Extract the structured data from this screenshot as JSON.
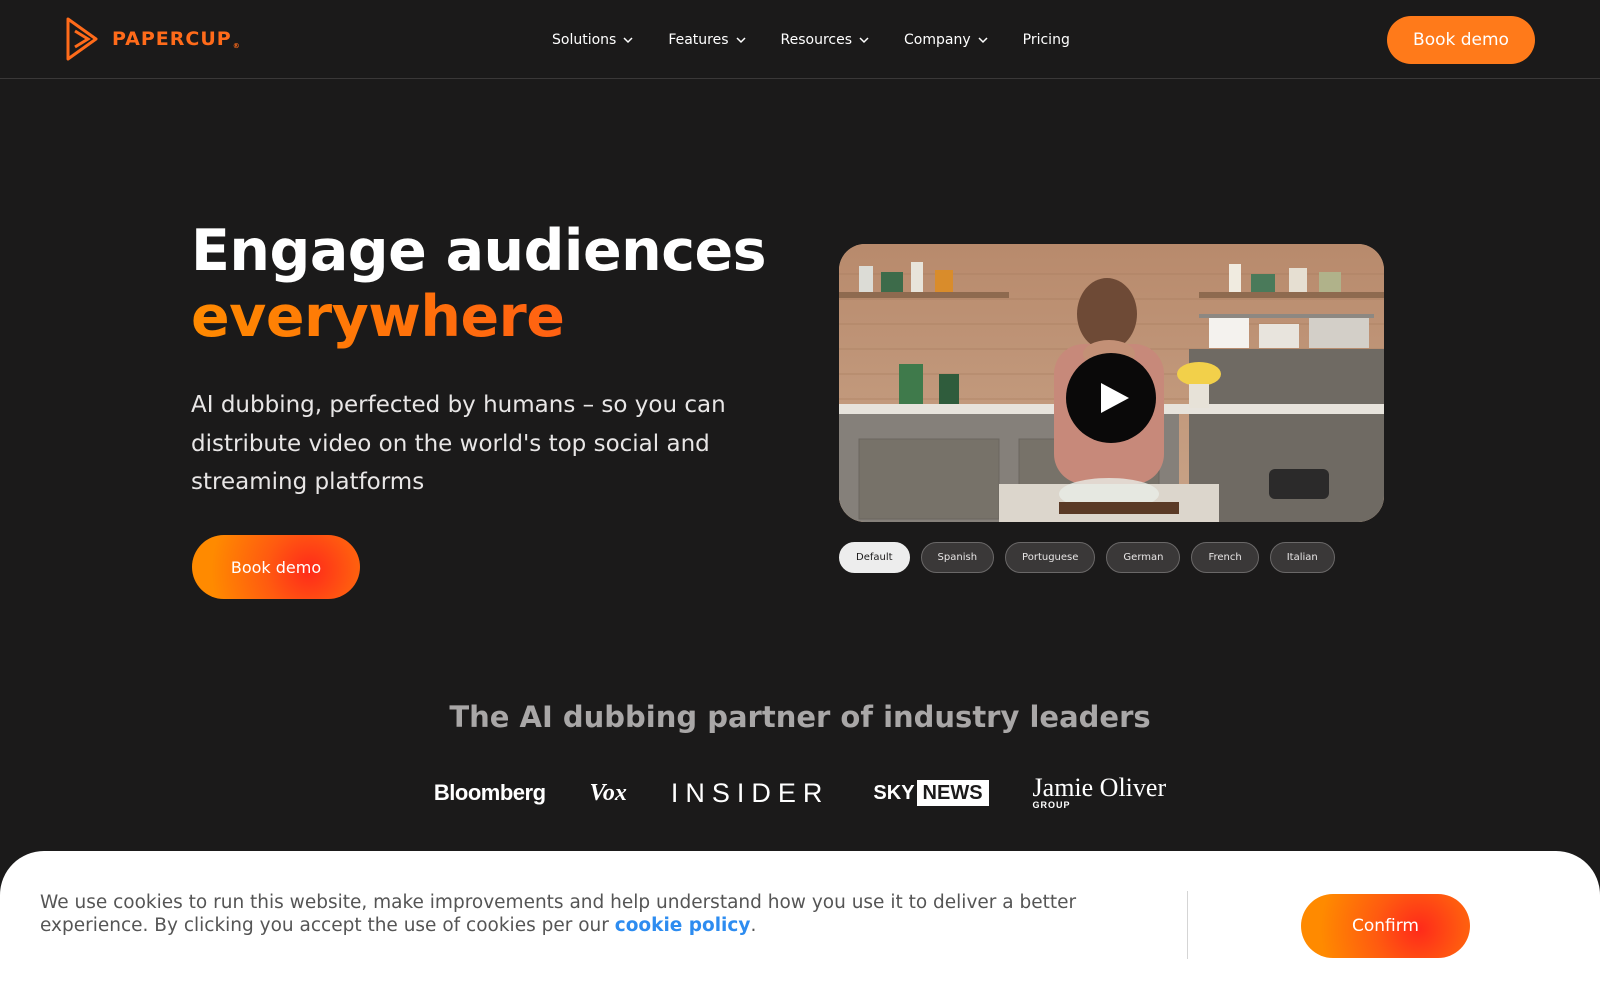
{
  "nav": {
    "logo_text": "PAPERCUP",
    "logo_reg": "®",
    "items": [
      {
        "label": "Solutions",
        "has_dropdown": true
      },
      {
        "label": "Features",
        "has_dropdown": true
      },
      {
        "label": "Resources",
        "has_dropdown": true
      },
      {
        "label": "Company",
        "has_dropdown": true
      },
      {
        "label": "Pricing",
        "has_dropdown": false
      }
    ],
    "cta": "Book demo"
  },
  "hero": {
    "title_line1": "Engage audiences",
    "title_line2": "everywhere",
    "subtitle": "AI dubbing, perfected by humans – so you can distribute video on the world's top social and streaming platforms",
    "cta": "Book demo"
  },
  "video": {
    "play_icon": "play-icon",
    "languages": [
      "Default",
      "Spanish",
      "Portuguese",
      "German",
      "French",
      "Italian"
    ],
    "active_language": "Default"
  },
  "partners": {
    "title": "The AI dubbing partner of industry leaders",
    "logos": {
      "bloomberg": "Bloomberg",
      "vox": "Vox",
      "insider": "INSIDER",
      "sky": "SKY",
      "news": "NEWS",
      "jamie": "Jamie Oliver",
      "jamie_group": "GROUP"
    }
  },
  "cookie": {
    "text_before": "We use cookies to run this website, make improvements and help understand how you use it to deliver a better experience. By clicking you accept the use of cookies per our ",
    "link": "cookie policy",
    "text_after": ".",
    "confirm": "Confirm"
  },
  "colors": {
    "background": "#1b1a1a",
    "accent": "#ff7a1a",
    "link": "#2d8cf0"
  }
}
